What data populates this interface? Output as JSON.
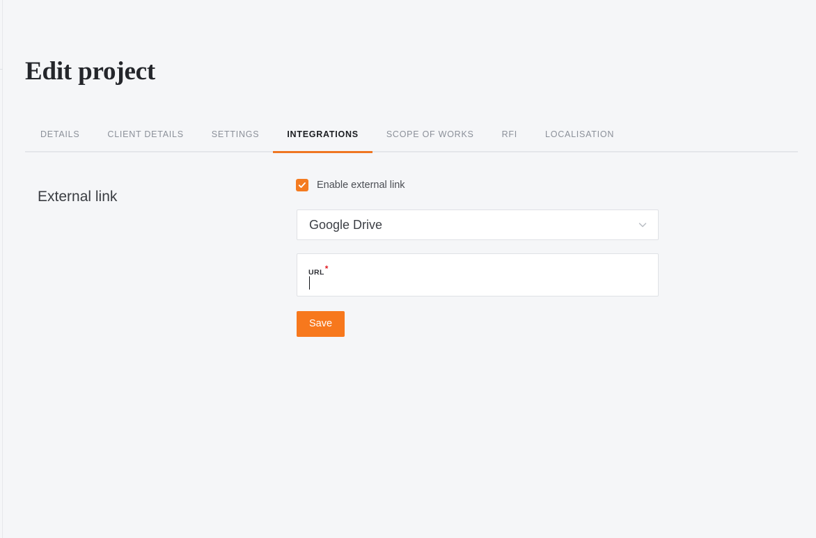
{
  "page": {
    "title": "Edit project"
  },
  "tabs": [
    {
      "label": "DETAILS",
      "active": false
    },
    {
      "label": "CLIENT DETAILS",
      "active": false
    },
    {
      "label": "SETTINGS",
      "active": false
    },
    {
      "label": "INTEGRATIONS",
      "active": true
    },
    {
      "label": "SCOPE OF WORKS",
      "active": false
    },
    {
      "label": "RFI",
      "active": false
    },
    {
      "label": "LOCALISATION",
      "active": false
    }
  ],
  "section": {
    "heading": "External link"
  },
  "form": {
    "enable_checkbox": {
      "label": "Enable external link",
      "checked": true,
      "icon": "check-icon"
    },
    "provider_select": {
      "value": "Google Drive",
      "icon": "chevron-down-icon"
    },
    "url_field": {
      "label": "URL",
      "required_marker": "*",
      "value": "",
      "placeholder": ""
    },
    "save_button": {
      "label": "Save"
    }
  },
  "colors": {
    "accent_orange": "#f7781d",
    "checkbox_orange": "#f47b20",
    "tab_underline": "#ef7622",
    "required_red": "#e01b22",
    "page_background": "#f5f6f8",
    "field_border": "#dfe1e5",
    "tab_inactive_text": "#8b9099",
    "tab_active_text": "#1b1d21"
  }
}
